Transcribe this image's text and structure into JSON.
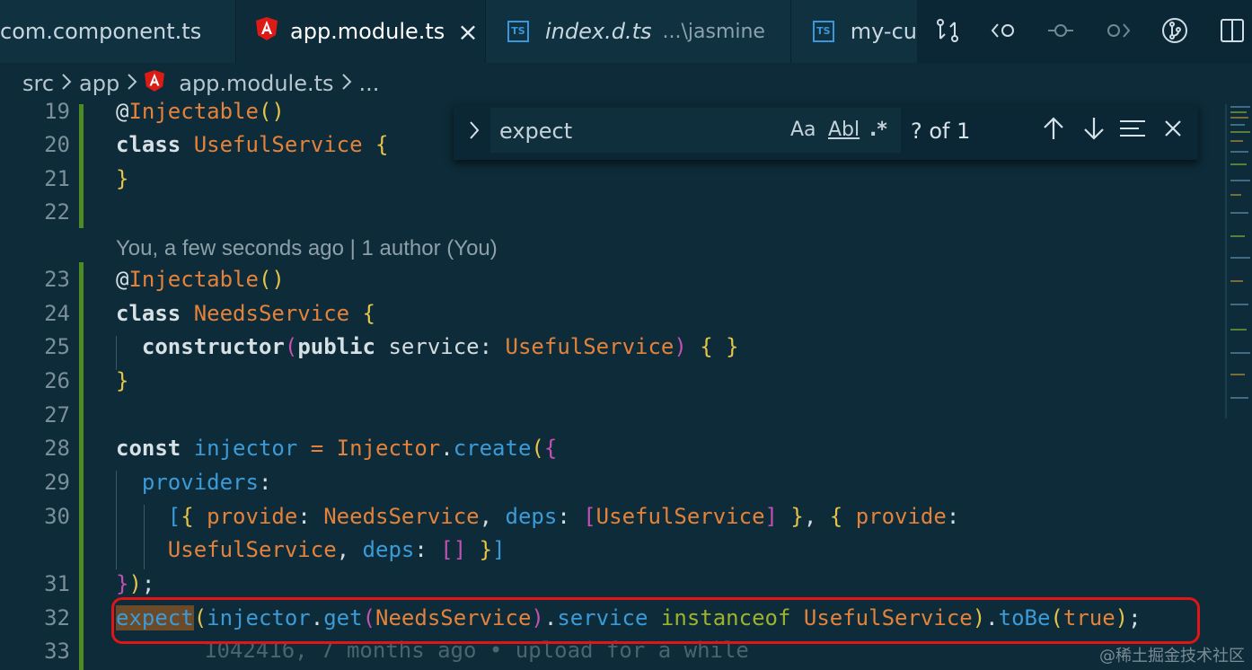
{
  "tabs": [
    {
      "label": "com.component.ts",
      "icon": "none",
      "active": false
    },
    {
      "label": "app.module.ts",
      "icon": "angular-icon",
      "active": true,
      "close": "×"
    },
    {
      "label": "index.d.ts",
      "hint": "...\\jasmine",
      "icon": "ts-icon",
      "active": false
    },
    {
      "label": "my-cu",
      "icon": "ts-icon",
      "active": false
    }
  ],
  "ts_badge": "TS",
  "toolbar_icons": [
    "compare-changes-icon",
    "go-back-icon",
    "commit-icon",
    "go-forward-icon",
    "source-control-icon",
    "split-editor-icon"
  ],
  "breadcrumb": {
    "items": [
      "src",
      "app",
      "app.module.ts",
      "..."
    ]
  },
  "find": {
    "value": "expect",
    "match_case": "Aa",
    "whole_word": "Abl",
    "regex": ".*",
    "count": "? of 1"
  },
  "blame": {
    "inline": "You, a few seconds ago | 1 author (You)",
    "ghost": "1042416, 7 months ago • upload for a while"
  },
  "line_numbers": [
    "19",
    "20",
    "21",
    "22",
    "23",
    "24",
    "25",
    "26",
    "27",
    "28",
    "29",
    "30",
    "31",
    "32",
    "33"
  ],
  "code": {
    "l19_at": "@",
    "l19_dec": "Injectable",
    "l19_p": "()",
    "l20_kw": "class",
    "l20_cls": "UsefulService",
    "l20_br": "{",
    "l21_br": "}",
    "l23_at": "@",
    "l23_dec": "Injectable",
    "l23_p": "()",
    "l24_kw": "class",
    "l24_cls": "NeedsService",
    "l24_br": "{",
    "l25_kw": "constructor",
    "l25_p1": "(",
    "l25_kw2": "public",
    "l25_var": "service",
    "l25_colon": ":",
    "l25_type": "UsefulService",
    "l25_p2": ")",
    "l25_body": "{ }",
    "l26_br": "}",
    "l28_kw": "const",
    "l28_var": "injector",
    "l28_eq": "=",
    "l28_cls": "Injector",
    "l28_dot": ".",
    "l28_fn": "create",
    "l28_p": "(",
    "l28_b": "{",
    "l29_prop": "providers",
    "l29_colon": ":",
    "l30_open": "[",
    "l30_b1": "{",
    "l30_prop1": "provide",
    "l30_c1": ":",
    "l30_cls1": "NeedsService",
    "l30_comma1": ",",
    "l30_prop2": "deps",
    "l30_c2": ":",
    "l30_a1": "[",
    "l30_cls2": "UsefulService",
    "l30_a2": "]",
    "l30_b2": "}",
    "l30_comma2": ",",
    "l30_b3": "{",
    "l30_prop3": "provide",
    "l30_c3": ":",
    "l30w_cls": "UsefulService",
    "l30w_comma": ",",
    "l30w_prop": "deps",
    "l30w_c": ":",
    "l30w_arr": "[]",
    "l30w_b": "}",
    "l30w_close": "]",
    "l31_b": "}",
    "l31_p": ")",
    "l31_semi": ";",
    "l32_match": "expect",
    "l32_p1": "(",
    "l32_var": "injector",
    "l32_dot1": ".",
    "l32_fn1": "get",
    "l32_p2": "(",
    "l32_cls1": "NeedsService",
    "l32_p3": ")",
    "l32_dot2": ".",
    "l32_prop": "service",
    "l32_kw": "instanceof",
    "l32_cls2": "UsefulService",
    "l32_p4": ")",
    "l32_dot3": ".",
    "l32_fn2": "toBe",
    "l32_p5": "(",
    "l32_true": "true",
    "l32_p6": ")",
    "l32_semi": ";"
  },
  "watermark": "@稀土掘金技术社区",
  "colors": {
    "git_bar": "#4f8b23",
    "highlight_border": "#e11515",
    "angular": "#dd1b16",
    "ts": "#3a96dd"
  }
}
